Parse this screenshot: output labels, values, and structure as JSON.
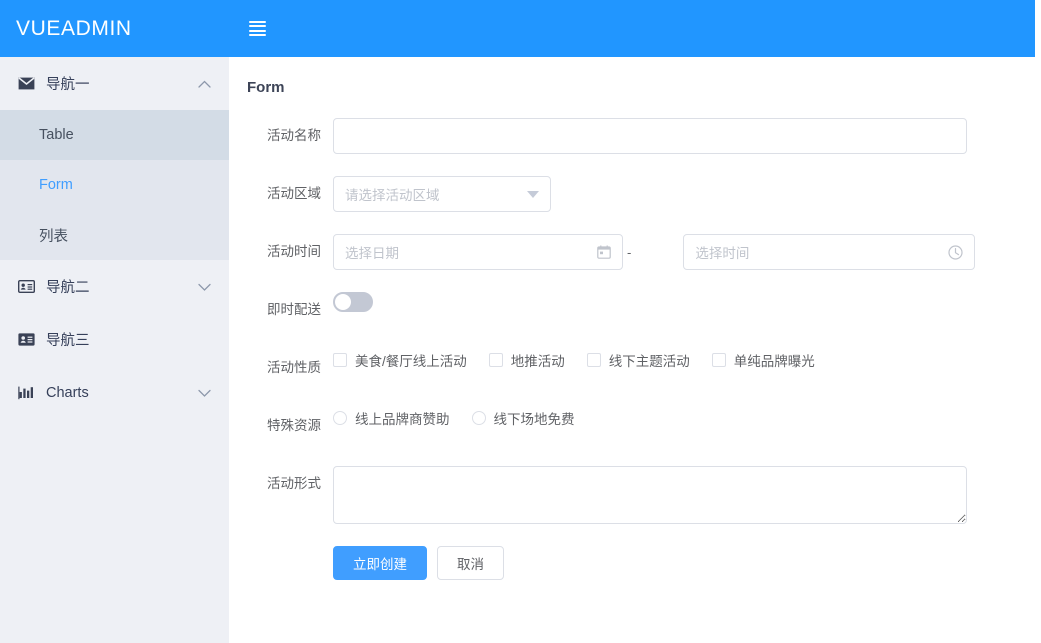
{
  "brand": {
    "title": "VUEADMIN"
  },
  "topbar": {
    "menu_icon": "hamburger-icon"
  },
  "sidebar": {
    "groups": [
      {
        "label": "导航一",
        "icon": "envelope-icon",
        "expanded": true,
        "chevron": "chevron-up-icon",
        "children": [
          {
            "label": "Table",
            "state": "hover"
          },
          {
            "label": "Form",
            "state": "active"
          },
          {
            "label": "列表",
            "state": "normal"
          }
        ]
      },
      {
        "label": "导航二",
        "icon": "id-card-outline-icon",
        "expanded": false,
        "chevron": "chevron-down-icon",
        "children": []
      },
      {
        "label": "导航三",
        "icon": "id-card-filled-icon",
        "expanded": false,
        "chevron": "",
        "children": []
      },
      {
        "label": "Charts",
        "icon": "bar-chart-icon",
        "expanded": false,
        "chevron": "chevron-down-icon",
        "children": []
      }
    ]
  },
  "page": {
    "title": "Form"
  },
  "form": {
    "name": {
      "label": "活动名称",
      "value": "",
      "placeholder": ""
    },
    "region": {
      "label": "活动区域",
      "value": "",
      "placeholder": "请选择活动区域",
      "caret": "caret-down-icon"
    },
    "time": {
      "label": "活动时间",
      "date_placeholder": "选择日期",
      "date_value": "",
      "date_icon": "calendar-icon",
      "separator": "-",
      "time_placeholder": "选择时间",
      "time_value": "",
      "time_icon": "clock-icon"
    },
    "delivery": {
      "label": "即时配送",
      "checked": false
    },
    "nature": {
      "label": "活动性质",
      "options": [
        {
          "label": "美食/餐厅线上活动",
          "checked": false
        },
        {
          "label": "地推活动",
          "checked": false
        },
        {
          "label": "线下主题活动",
          "checked": false
        },
        {
          "label": "单纯品牌曝光",
          "checked": false
        }
      ]
    },
    "resource": {
      "label": "特殊资源",
      "options": [
        {
          "label": "线上品牌商赞助",
          "checked": false
        },
        {
          "label": "线下场地免费",
          "checked": false
        }
      ]
    },
    "format": {
      "label": "活动形式",
      "value": "",
      "placeholder": ""
    },
    "actions": {
      "submit_label": "立即创建",
      "cancel_label": "取消"
    }
  },
  "colors": {
    "brand_blue": "#2196ff",
    "primary": "#409eff",
    "sidebar_bg": "#eef0f5",
    "submenu_bg": "#e2e6ee",
    "submenu_hover": "#d3dce6",
    "border": "#dcdfe6",
    "placeholder": "#c0c4cc",
    "text": "#606266"
  }
}
